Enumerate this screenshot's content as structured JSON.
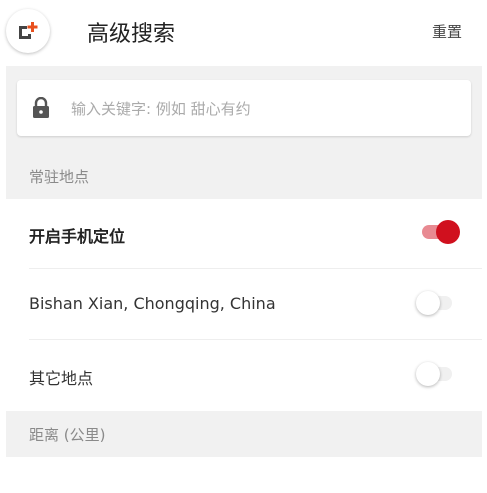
{
  "header": {
    "back_icon": "add-location-icon",
    "title": "高级搜索",
    "reset_label": "重置"
  },
  "search": {
    "placeholder": "输入关键字: 例如 甜心有约",
    "value": ""
  },
  "location_section": {
    "title": "常驻地点",
    "rows": [
      {
        "label": "开启手机定位",
        "toggle_on": true
      },
      {
        "label": "Bishan Xian, Chongqing, China",
        "toggle_on": false
      },
      {
        "label": "其它地点",
        "toggle_on": false
      }
    ]
  },
  "distance_section": {
    "title": "距离 (公里)"
  },
  "colors": {
    "accent": "#d0101e",
    "accent_track": "#e88a92",
    "section_bg": "#f1f1f1"
  }
}
